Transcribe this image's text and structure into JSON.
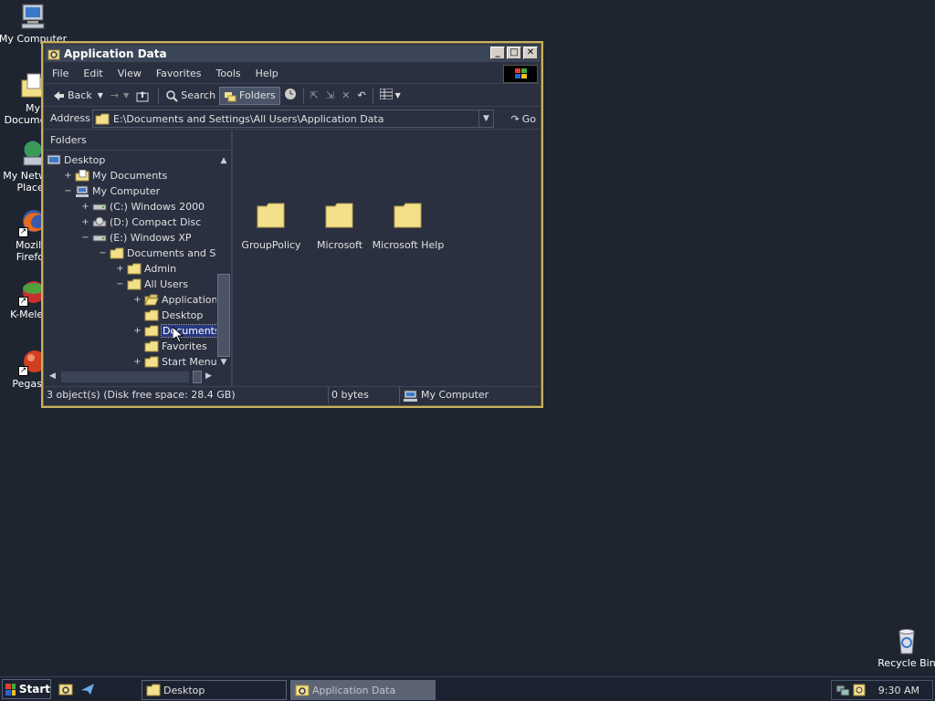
{
  "desktop": {
    "icons": [
      {
        "label": "My Computer"
      },
      {
        "label": "My Documents"
      },
      {
        "label": "My Network Places"
      },
      {
        "label": "Mozilla Firefox"
      },
      {
        "label": "K-Meleon"
      },
      {
        "label": "Pegasus"
      },
      {
        "label": "Recycle Bin"
      }
    ]
  },
  "window": {
    "title": "Application Data",
    "menu": [
      "File",
      "Edit",
      "View",
      "Favorites",
      "Tools",
      "Help"
    ],
    "toolbar": {
      "back": "Back",
      "search": "Search",
      "folders": "Folders"
    },
    "address": {
      "label": "Address",
      "value": "E:\\Documents and Settings\\All Users\\Application Data",
      "go": "Go"
    },
    "folders_header": "Folders",
    "tree": [
      {
        "label": "Desktop",
        "expander": "",
        "icon": "desktop-icon"
      },
      {
        "label": "My Documents",
        "expander": "+",
        "icon": "my-documents-icon"
      },
      {
        "label": "My Computer",
        "expander": "−",
        "icon": "my-computer-icon"
      },
      {
        "label": "(C:) Windows 2000",
        "expander": "+",
        "icon": "drive-icon"
      },
      {
        "label": "(D:) Compact Disc",
        "expander": "+",
        "icon": "cd-drive-icon"
      },
      {
        "label": "(E:) Windows XP",
        "expander": "−",
        "icon": "drive-icon"
      },
      {
        "label": "Documents and Settings",
        "expander": "−",
        "icon": "folder-icon"
      },
      {
        "label": "Admin",
        "expander": "+",
        "icon": "folder-icon"
      },
      {
        "label": "All Users",
        "expander": "−",
        "icon": "folder-icon"
      },
      {
        "label": "Application Data",
        "expander": "+",
        "icon": "folder-open-icon"
      },
      {
        "label": "Desktop",
        "expander": "",
        "icon": "folder-icon"
      },
      {
        "label": "Documents",
        "expander": "+",
        "icon": "folder-icon",
        "selected": true
      },
      {
        "label": "Favorites",
        "expander": "",
        "icon": "folder-icon"
      },
      {
        "label": "Start Menu",
        "expander": "+",
        "icon": "folder-icon"
      }
    ],
    "items": [
      {
        "label": "GroupPolicy"
      },
      {
        "label": "Microsoft"
      },
      {
        "label": "Microsoft Help"
      }
    ],
    "status": {
      "objects": "3 object(s) (Disk free space: 28.4 GB)",
      "size": "0 bytes",
      "zone": "My Computer"
    }
  },
  "taskbar": {
    "start": "Start",
    "tasks": [
      {
        "label": "Desktop"
      },
      {
        "label": "Application Data"
      }
    ],
    "clock": "9:30 AM"
  },
  "colors": {
    "folder": "#f4e08a",
    "selection": "#283880",
    "window_border": "#c8b060"
  }
}
